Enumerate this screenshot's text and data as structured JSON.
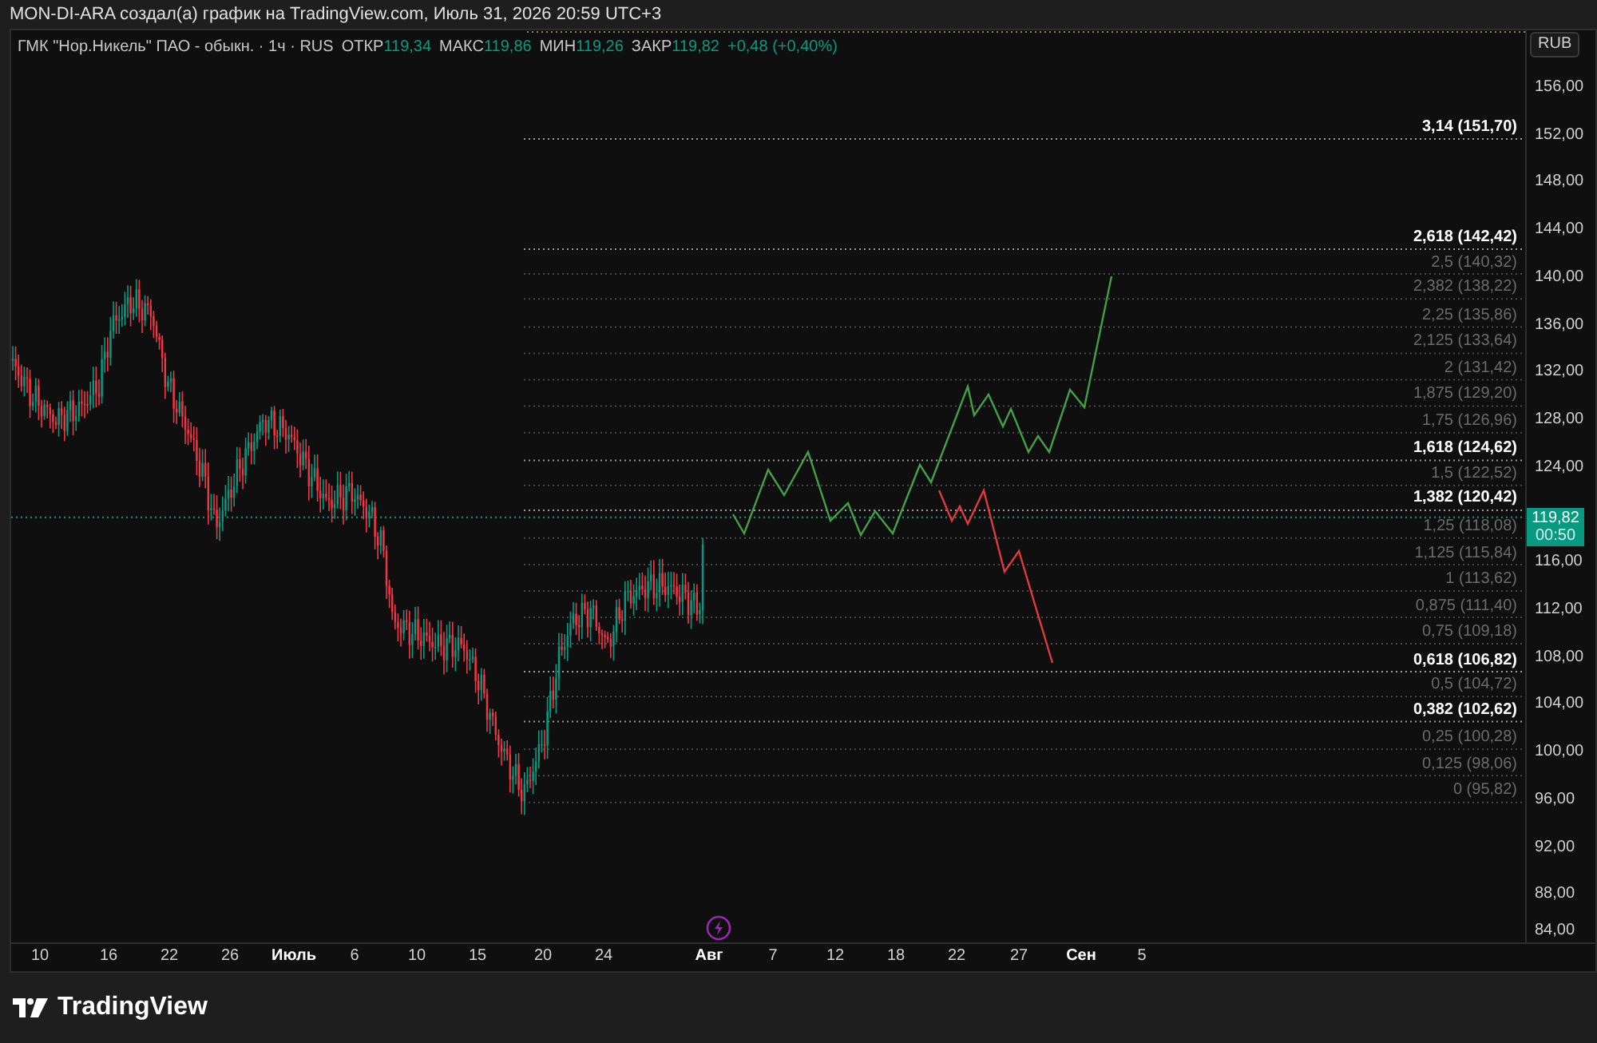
{
  "header": {
    "caption": "MON-DI-ARA создал(а) график на TradingView.com, Июль 31, 2026 20:59 UTC+3"
  },
  "legend": {
    "symbol": "ГМК \"Нор.Никель\" ПАО - обыкн. · 1ч · RUS",
    "fields": [
      {
        "label": "ОТКР",
        "value": "119,34"
      },
      {
        "label": "МАКС",
        "value": "119,86"
      },
      {
        "label": "МИН",
        "value": "119,26"
      },
      {
        "label": "ЗАКР",
        "value": "119,82"
      }
    ],
    "change": "+0,48 (+0,40%)"
  },
  "currency_button": "RUB",
  "price_axis": [
    "156,00",
    "152,00",
    "148,00",
    "144,00",
    "140,00",
    "136,00",
    "132,00",
    "128,00",
    "124,00",
    "116,00",
    "112,00",
    "108,00",
    "104,00",
    "100,00",
    "96,00",
    "92,00",
    "88,00",
    "84,00"
  ],
  "current_price": {
    "price": "119,82",
    "countdown": "00:50"
  },
  "fib_levels": [
    {
      "label": "3,14 (151,70)",
      "major": true
    },
    {
      "label": "2,618 (142,42)",
      "major": true
    },
    {
      "label": "2,5 (140,32)",
      "major": false
    },
    {
      "label": "2,382 (138,22)",
      "major": false
    },
    {
      "label": "2,25 (135,86)",
      "major": false
    },
    {
      "label": "2,125 (133,64)",
      "major": false
    },
    {
      "label": "2 (131,42)",
      "major": false
    },
    {
      "label": "1,875 (129,20)",
      "major": false
    },
    {
      "label": "1,75 (126,96)",
      "major": false
    },
    {
      "label": "1,618 (124,62)",
      "major": true
    },
    {
      "label": "1,5 (122,52)",
      "major": false
    },
    {
      "label": "1,382 (120,42)",
      "major": true
    },
    {
      "label": "1,25 (118,08)",
      "major": false
    },
    {
      "label": "1,125 (115,84)",
      "major": false
    },
    {
      "label": "1 (113,62)",
      "major": false
    },
    {
      "label": "0,875 (111,40)",
      "major": false
    },
    {
      "label": "0,75 (109,18)",
      "major": false
    },
    {
      "label": "0,618 (106,82)",
      "major": true
    },
    {
      "label": "0,5 (104,72)",
      "major": false
    },
    {
      "label": "0,382 (102,62)",
      "major": true
    },
    {
      "label": "0,25 (100,28)",
      "major": false
    },
    {
      "label": "0,125 (98,06)",
      "major": false
    },
    {
      "label": "0 (95,82)",
      "major": false
    }
  ],
  "time_axis": [
    {
      "label": "10",
      "kind": "day"
    },
    {
      "label": "16",
      "kind": "day"
    },
    {
      "label": "22",
      "kind": "day"
    },
    {
      "label": "26",
      "kind": "day"
    },
    {
      "label": "Июль",
      "kind": "month"
    },
    {
      "label": "6",
      "kind": "day"
    },
    {
      "label": "10",
      "kind": "day"
    },
    {
      "label": "15",
      "kind": "day"
    },
    {
      "label": "20",
      "kind": "day"
    },
    {
      "label": "24",
      "kind": "day"
    },
    {
      "label": "Авг",
      "kind": "month"
    },
    {
      "label": "7",
      "kind": "day"
    },
    {
      "label": "12",
      "kind": "day"
    },
    {
      "label": "18",
      "kind": "day"
    },
    {
      "label": "22",
      "kind": "day"
    },
    {
      "label": "27",
      "kind": "day"
    },
    {
      "label": "Сен",
      "kind": "month"
    },
    {
      "label": "5",
      "kind": "day"
    }
  ],
  "footer": {
    "brand": "TradingView"
  }
}
